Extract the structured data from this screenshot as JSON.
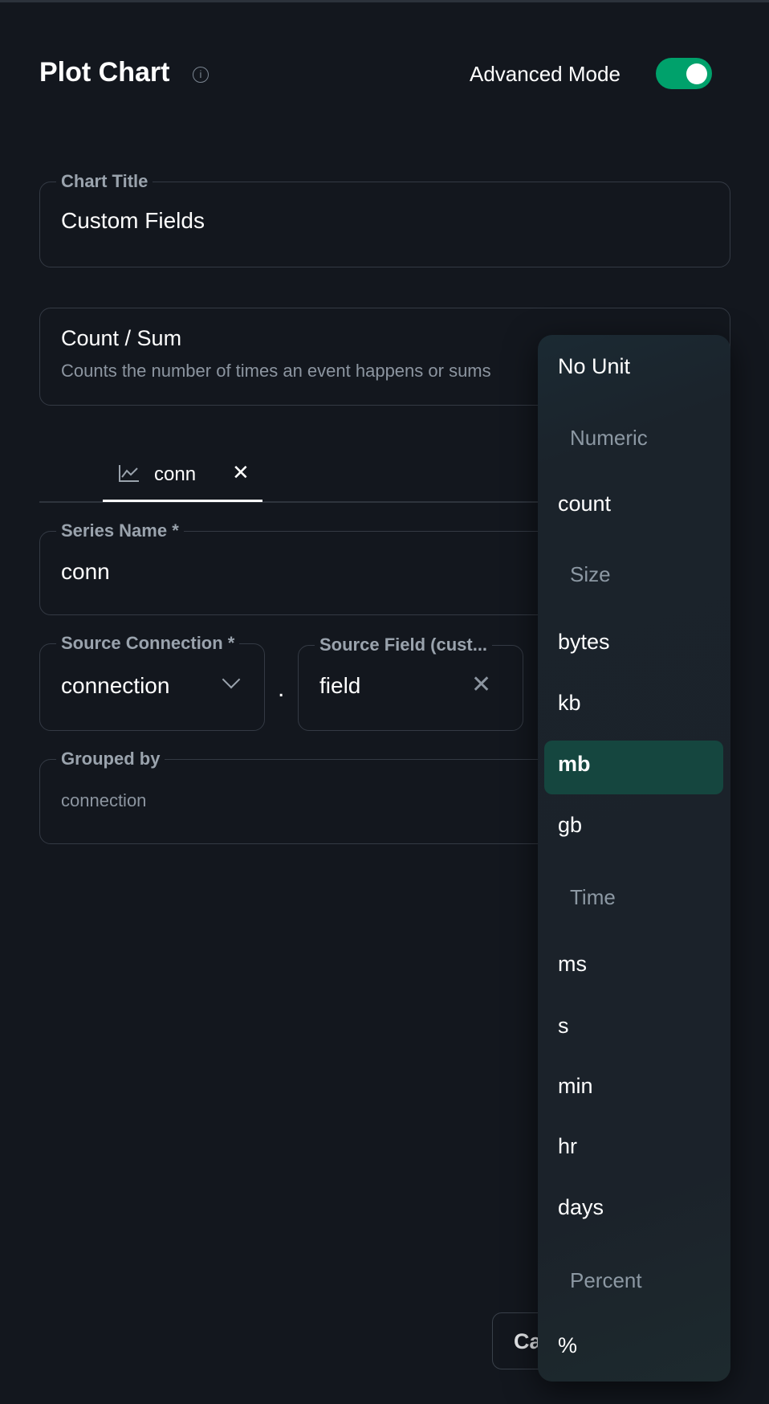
{
  "header": {
    "title": "Plot Chart",
    "advanced_mode_label": "Advanced Mode",
    "advanced_mode_on": true
  },
  "chart_title": {
    "label": "Chart Title",
    "value": "Custom Fields"
  },
  "aggregation": {
    "title": "Count / Sum",
    "description": "Counts the number of times an event happens or sums"
  },
  "series_tab": {
    "label": "conn"
  },
  "series_name": {
    "label": "Series Name *",
    "value": "conn"
  },
  "source_connection": {
    "label": "Source Connection *",
    "value": "connection"
  },
  "separator": ".",
  "source_field": {
    "label": "Source Field (cust...",
    "value": "field"
  },
  "grouped_by": {
    "label": "Grouped by",
    "placeholder": "connection"
  },
  "footer": {
    "cancel_label": "Ca"
  },
  "unit_dropdown": {
    "selected": "mb",
    "items": [
      {
        "type": "option",
        "label": "No Unit"
      },
      {
        "type": "group",
        "label": "Numeric"
      },
      {
        "type": "option",
        "label": "count"
      },
      {
        "type": "group",
        "label": "Size"
      },
      {
        "type": "option",
        "label": "bytes"
      },
      {
        "type": "option",
        "label": "kb"
      },
      {
        "type": "option",
        "label": "mb"
      },
      {
        "type": "option",
        "label": "gb"
      },
      {
        "type": "group",
        "label": "Time"
      },
      {
        "type": "option",
        "label": "ms"
      },
      {
        "type": "option",
        "label": "s"
      },
      {
        "type": "option",
        "label": "min"
      },
      {
        "type": "option",
        "label": "hr"
      },
      {
        "type": "option",
        "label": "days"
      },
      {
        "type": "group",
        "label": "Percent"
      },
      {
        "type": "option",
        "label": "%"
      }
    ]
  },
  "colors": {
    "accent": "#00a16b",
    "selected_bg": "#15463f",
    "background": "#13171e"
  }
}
